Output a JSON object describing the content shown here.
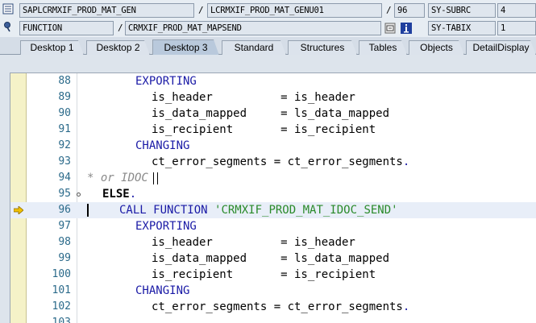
{
  "info_bar": {
    "program": "SAPLCRMXIF_PROD_MAT_GEN",
    "separator_1": "/",
    "include": "LCRMXIF_PROD_MAT_GENU01",
    "separator_2": "/",
    "line": "96",
    "var1_name": "SY-SUBRC",
    "var1_value": "4",
    "type": "FUNCTION",
    "separator_3": "/",
    "object": "CRMXIF_PROD_MAT_MAPSEND",
    "var2_name": "SY-TABIX",
    "var2_value": "1"
  },
  "tabs": [
    {
      "label": "Desktop 1",
      "active": false
    },
    {
      "label": "Desktop 2",
      "active": false
    },
    {
      "label": "Desktop 3",
      "active": true
    },
    {
      "label": "Standard",
      "active": false
    },
    {
      "label": "Structures",
      "active": false
    },
    {
      "label": "Tables",
      "active": false
    },
    {
      "label": "Objects",
      "active": false
    },
    {
      "label": "DetailDisplay",
      "active": false
    }
  ],
  "code_lines": [
    {
      "num": "88",
      "indent": 3,
      "segments": [
        {
          "t": "EXPORTING",
          "c": "kw"
        }
      ]
    },
    {
      "num": "89",
      "indent": 4,
      "segments": [
        {
          "t": "is_header          = is_header",
          "c": ""
        }
      ]
    },
    {
      "num": "90",
      "indent": 4,
      "segments": [
        {
          "t": "is_data_mapped     = ls_data_mapped",
          "c": ""
        }
      ]
    },
    {
      "num": "91",
      "indent": 4,
      "segments": [
        {
          "t": "is_recipient       = is_recipient",
          "c": ""
        }
      ]
    },
    {
      "num": "92",
      "indent": 3,
      "segments": [
        {
          "t": "CHANGING",
          "c": "kw"
        }
      ]
    },
    {
      "num": "93",
      "indent": 4,
      "segments": [
        {
          "t": "ct_error_segments = ct_error_segments",
          "c": ""
        },
        {
          "t": ".",
          "c": "kw"
        }
      ]
    },
    {
      "num": "94",
      "indent": 0,
      "segments": [
        {
          "t": "* or IDOC",
          "c": "cmt"
        }
      ]
    },
    {
      "num": "95",
      "indent": 1,
      "segments": [
        {
          "t": "ELSE",
          "c": "bold"
        },
        {
          "t": ".",
          "c": "kw"
        }
      ]
    },
    {
      "num": "96",
      "indent": 2,
      "segments": [
        {
          "t": "CALL FUNCTION ",
          "c": "kw"
        },
        {
          "t": "'CRMXIF_PROD_MAT_IDOC_SEND'",
          "c": "str"
        }
      ],
      "current": true
    },
    {
      "num": "97",
      "indent": 3,
      "segments": [
        {
          "t": "EXPORTING",
          "c": "kw"
        }
      ]
    },
    {
      "num": "98",
      "indent": 4,
      "segments": [
        {
          "t": "is_header          = is_header",
          "c": ""
        }
      ]
    },
    {
      "num": "99",
      "indent": 4,
      "segments": [
        {
          "t": "is_data_mapped     = ls_data_mapped",
          "c": ""
        }
      ]
    },
    {
      "num": "100",
      "indent": 4,
      "segments": [
        {
          "t": "is_recipient       = is_recipient",
          "c": ""
        }
      ]
    },
    {
      "num": "101",
      "indent": 3,
      "segments": [
        {
          "t": "CHANGING",
          "c": "kw"
        }
      ]
    },
    {
      "num": "102",
      "indent": 4,
      "segments": [
        {
          "t": "ct_error_segments = ct_error_segments",
          "c": ""
        },
        {
          "t": ".",
          "c": "kw"
        }
      ]
    },
    {
      "num": "103",
      "indent": 0,
      "segments": []
    }
  ],
  "colors": {
    "keyword": "#1a1aa6",
    "string": "#2a8a2a",
    "comment": "#8a8a8a",
    "breakpoint_gutter": "#f5f2c8",
    "current_line_arrow": "#f0c000"
  },
  "icons": {
    "program_icon": "list-icon",
    "function_icon": "pin-icon",
    "nav_icon": "navigate-icon",
    "info_icon": "info-icon",
    "current_line": "arrow-right-icon"
  }
}
